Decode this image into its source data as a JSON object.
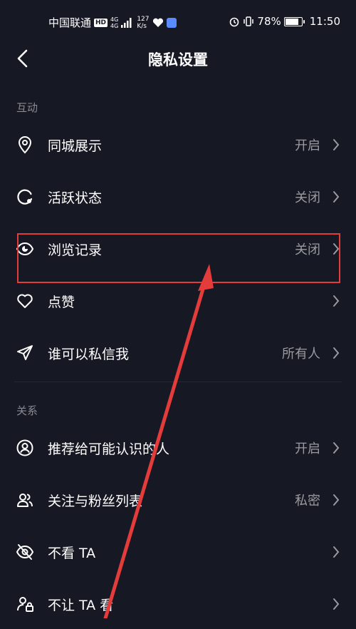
{
  "status_bar": {
    "carrier": "中国联通",
    "hd_badge": "HD",
    "network_top": "4G",
    "network_bottom": "4G",
    "speed_value": "127",
    "speed_unit": "K/s",
    "battery": "78%",
    "time": "11:50"
  },
  "header": {
    "title": "隐私设置"
  },
  "sections": [
    {
      "label": "互动",
      "rows": [
        {
          "label": "同城展示",
          "value": "开启",
          "icon": "location-pin-icon"
        },
        {
          "label": "活跃状态",
          "value": "关闭",
          "icon": "activity-status-icon"
        },
        {
          "label": "浏览记录",
          "value": "关闭",
          "icon": "eye-icon"
        },
        {
          "label": "点赞",
          "value": "",
          "icon": "heart-icon"
        },
        {
          "label": "谁可以私信我",
          "value": "所有人",
          "icon": "send-message-icon"
        }
      ]
    },
    {
      "label": "关系",
      "rows": [
        {
          "label": "推荐给可能认识的人",
          "value": "开启",
          "icon": "user-circle-icon"
        },
        {
          "label": "关注与粉丝列表",
          "value": "私密",
          "icon": "users-icon"
        },
        {
          "label": "不看 TA",
          "value": "",
          "icon": "eye-off-icon"
        },
        {
          "label": "不让 TA 看",
          "value": "",
          "icon": "user-lock-icon"
        }
      ]
    }
  ],
  "colors": {
    "background": "#161823",
    "annotation": "#e43b3b",
    "secondary_text": "#9a9ba0"
  }
}
